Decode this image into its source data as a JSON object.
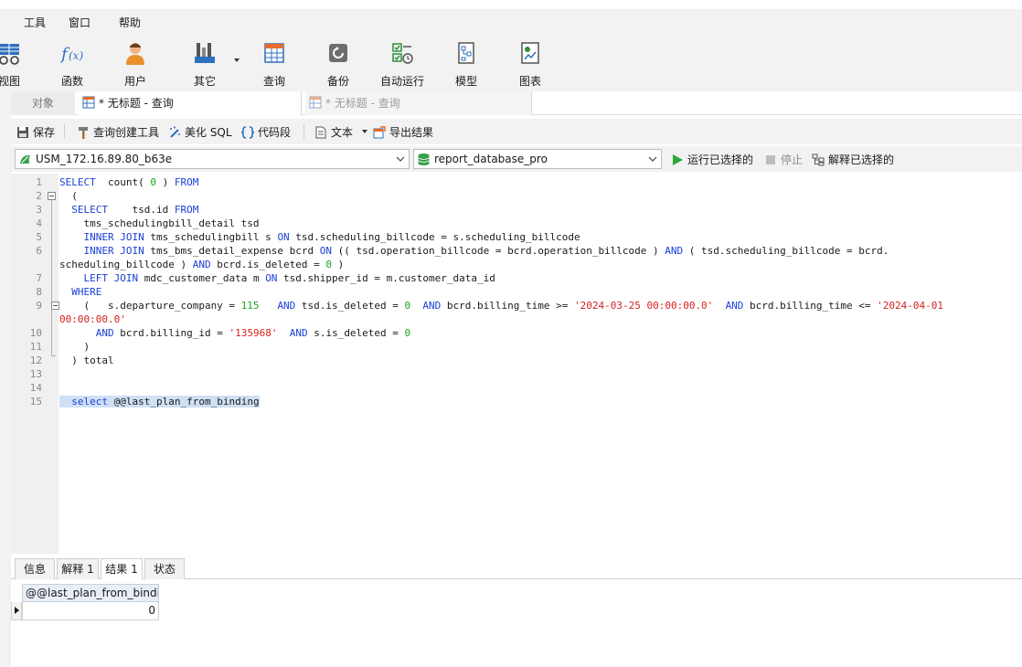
{
  "menu": {
    "items": [
      "工具",
      "窗口",
      "帮助"
    ]
  },
  "ribbon": {
    "buttons": [
      {
        "label": "视图",
        "icon": "view-icon"
      },
      {
        "label": "函数",
        "icon": "function-icon"
      },
      {
        "label": "用户",
        "icon": "user-icon"
      },
      {
        "label": "其它",
        "icon": "tools-icon"
      },
      {
        "label": "查询",
        "icon": "query-icon"
      },
      {
        "label": "备份",
        "icon": "backup-icon"
      },
      {
        "label": "自动运行",
        "icon": "schedule-icon"
      },
      {
        "label": "模型",
        "icon": "model-icon"
      },
      {
        "label": "图表",
        "icon": "chart-icon"
      }
    ]
  },
  "tabs": {
    "object_label": "对象",
    "query_tab_1": "* 无标题 - 查询",
    "query_tab_2": "* 无标题 - 查询"
  },
  "toolbar": {
    "save": "保存",
    "query_builder": "查询创建工具",
    "beautify_sql": "美化 SQL",
    "snippet": "代码段",
    "text": "文本",
    "export": "导出结果"
  },
  "connection": {
    "connection_name": "USM_172.16.89.80_b63e",
    "database_name": "report_database_pro",
    "run_selected": "运行已选择的",
    "stop": "停止",
    "explain_selected": "解释已选择的"
  },
  "editor": {
    "line_numbers": [
      "1",
      "2",
      "3",
      "4",
      "5",
      "6",
      "7",
      "8",
      "9",
      "10",
      "11",
      "12",
      "13",
      "14",
      "15"
    ]
  },
  "results": {
    "tabs": [
      "信息",
      "解释 1",
      "结果 1",
      "状态"
    ],
    "active_tab": "结果 1",
    "column_header": "@@last_plan_from_binding",
    "cell_value": "0"
  },
  "colors": {
    "keyword": "#1a3fd6",
    "number": "#1aa51a",
    "string": "#d6221f",
    "selection": "#cfe0f5",
    "toolbar_bg": "#f2f2f2"
  }
}
